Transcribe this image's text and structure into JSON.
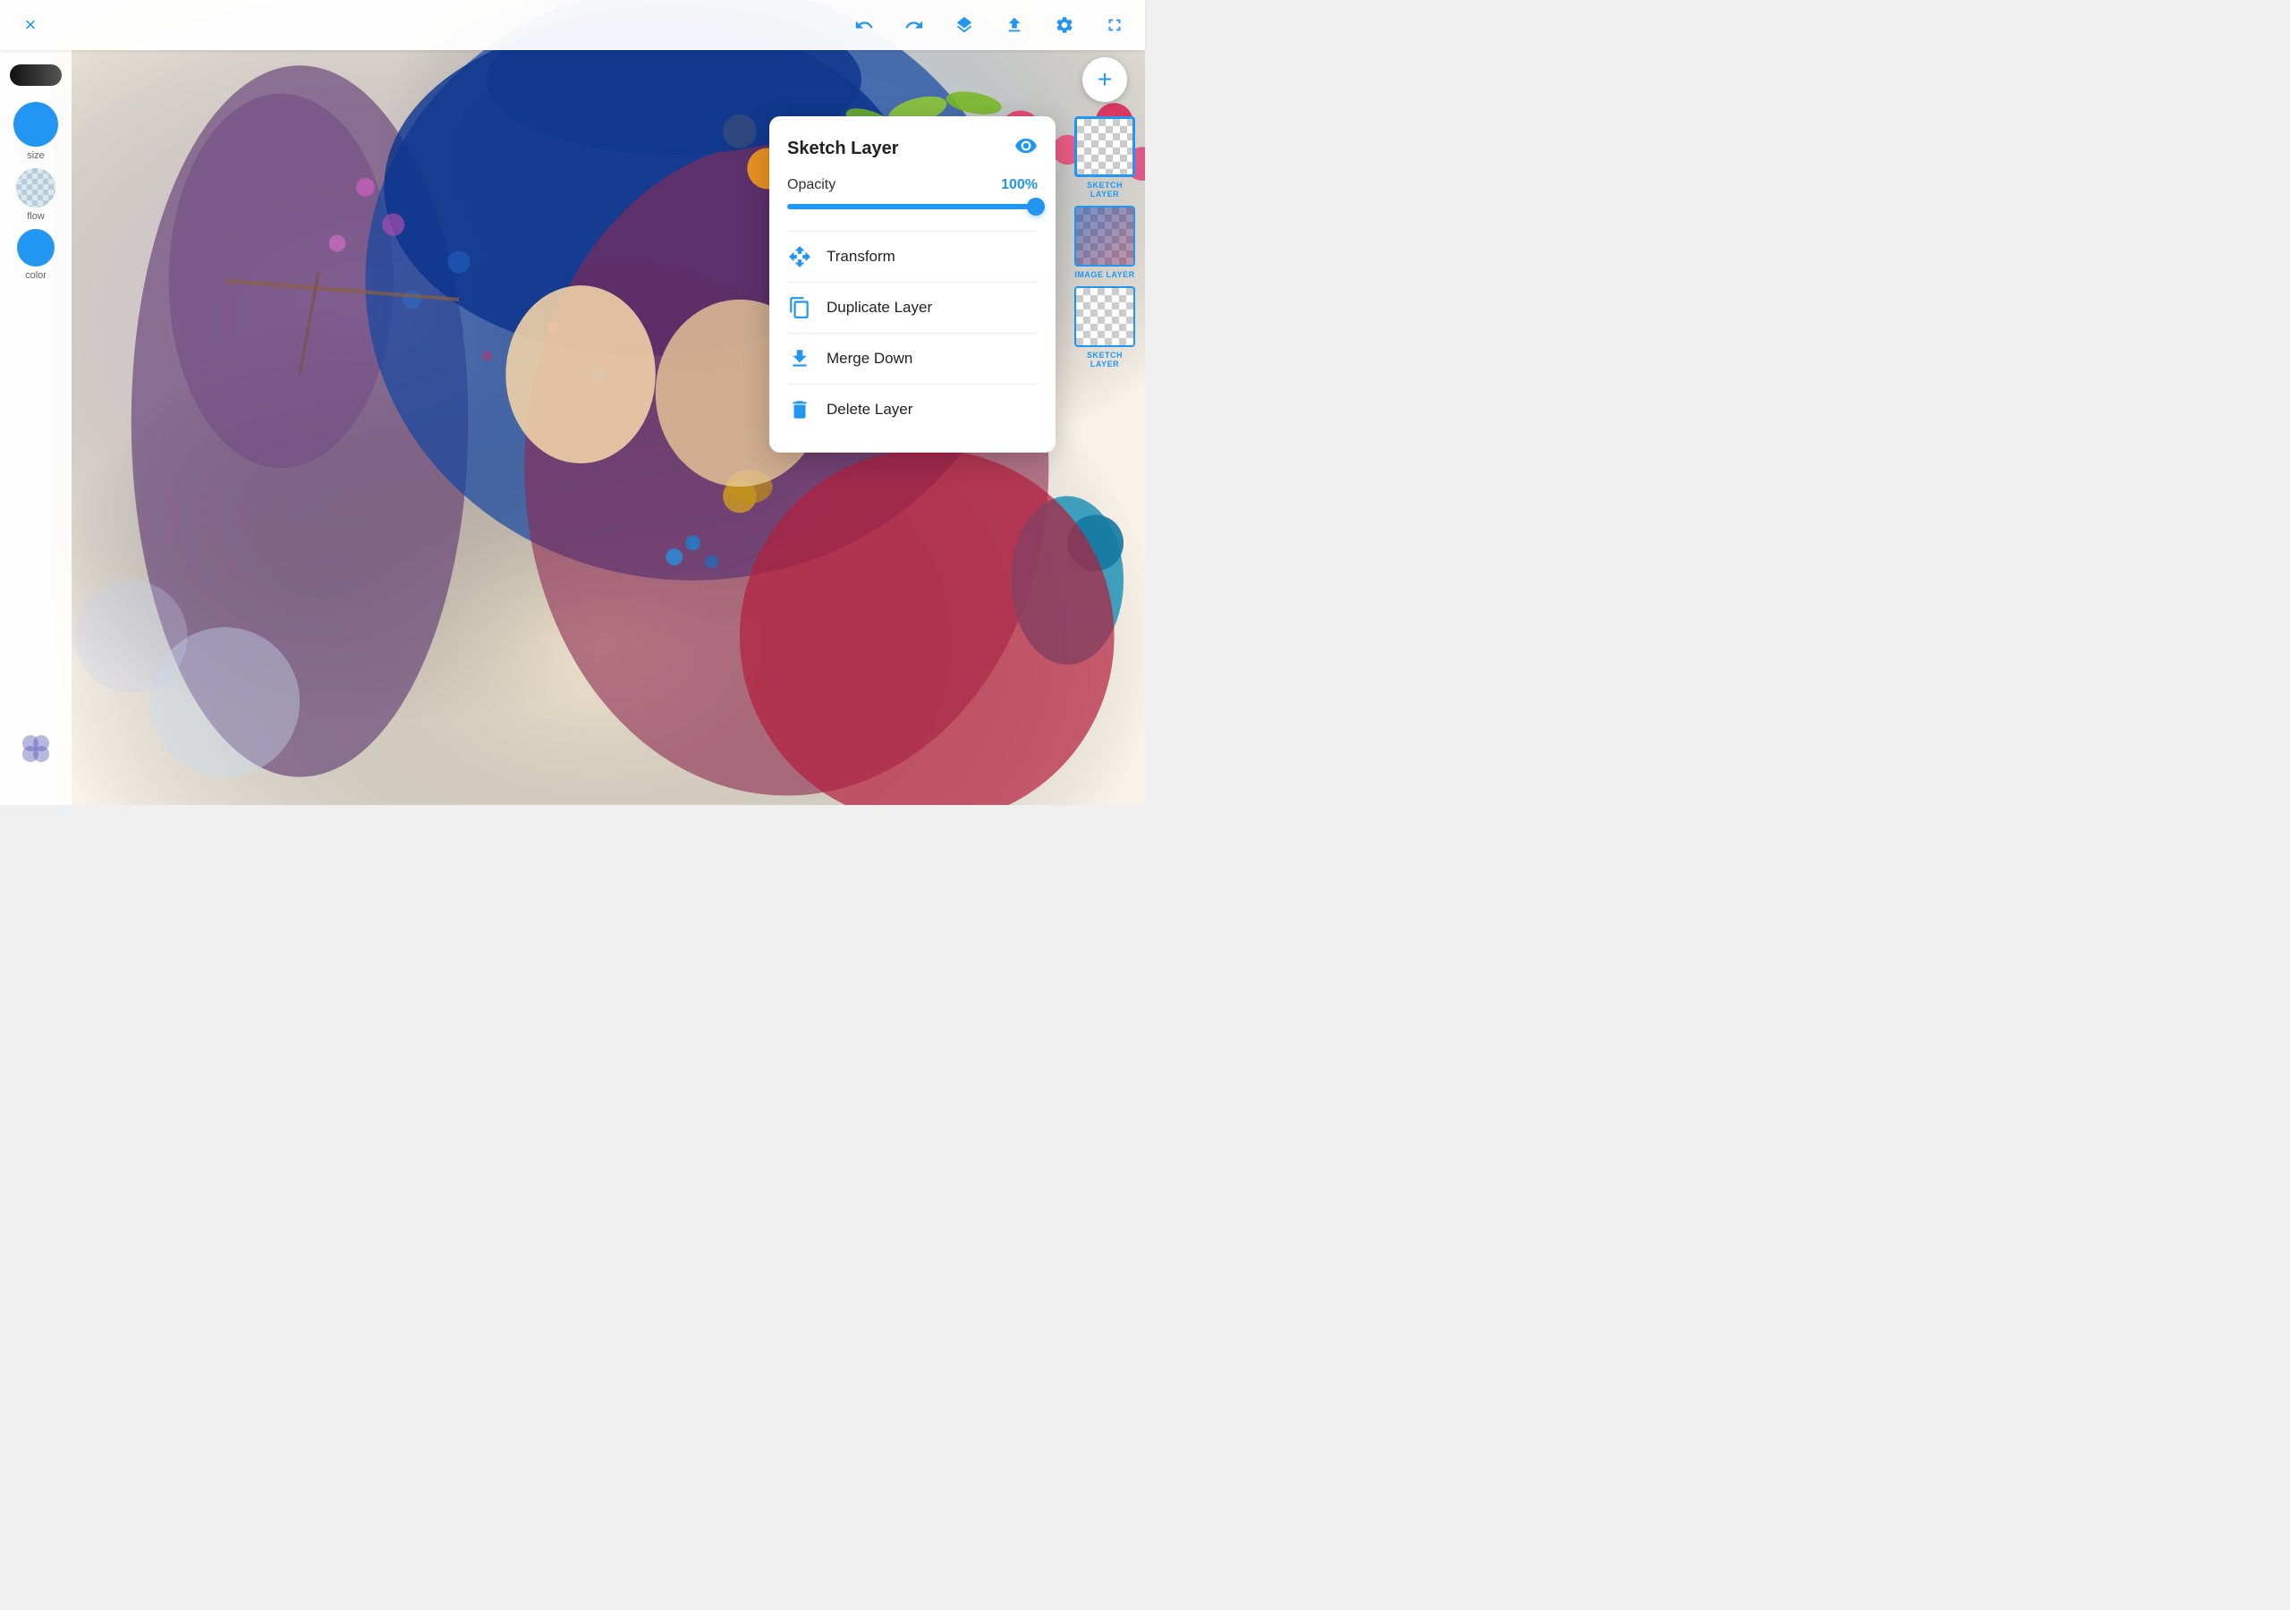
{
  "toolbar": {
    "close_label": "×",
    "undo_label": "↩",
    "redo_label": "↪",
    "layers_label": "⧉",
    "upload_label": "⬆",
    "settings_label": "⚙",
    "fullscreen_label": "⛶"
  },
  "left_panel": {
    "size_label": "size",
    "flow_label": "flow",
    "color_label": "color",
    "size_color": "#2196F3",
    "flow_color": "#9bb8d4",
    "color_circle_color": "#2196F3",
    "size_px": "50",
    "flow_px": "40",
    "color_px": "38"
  },
  "context_menu": {
    "title": "Sketch Layer",
    "visibility_icon": "👁",
    "opacity_label": "Opacity",
    "opacity_value": "100%",
    "items": [
      {
        "id": "transform",
        "label": "Transform",
        "icon": "⊕"
      },
      {
        "id": "duplicate",
        "label": "Duplicate Layer",
        "icon": "❏"
      },
      {
        "id": "merge",
        "label": "Merge Down",
        "icon": "⬇"
      },
      {
        "id": "delete",
        "label": "Delete Layer",
        "icon": "🗑"
      }
    ]
  },
  "layers": {
    "add_button_label": "+",
    "items": [
      {
        "id": "sketch-top",
        "label": "SKETCH LAYER",
        "active": true
      },
      {
        "id": "image",
        "label": "IMAGE LAYER",
        "active": false
      },
      {
        "id": "sketch-bottom",
        "label": "SKETCH LAYER",
        "active": false
      }
    ]
  }
}
